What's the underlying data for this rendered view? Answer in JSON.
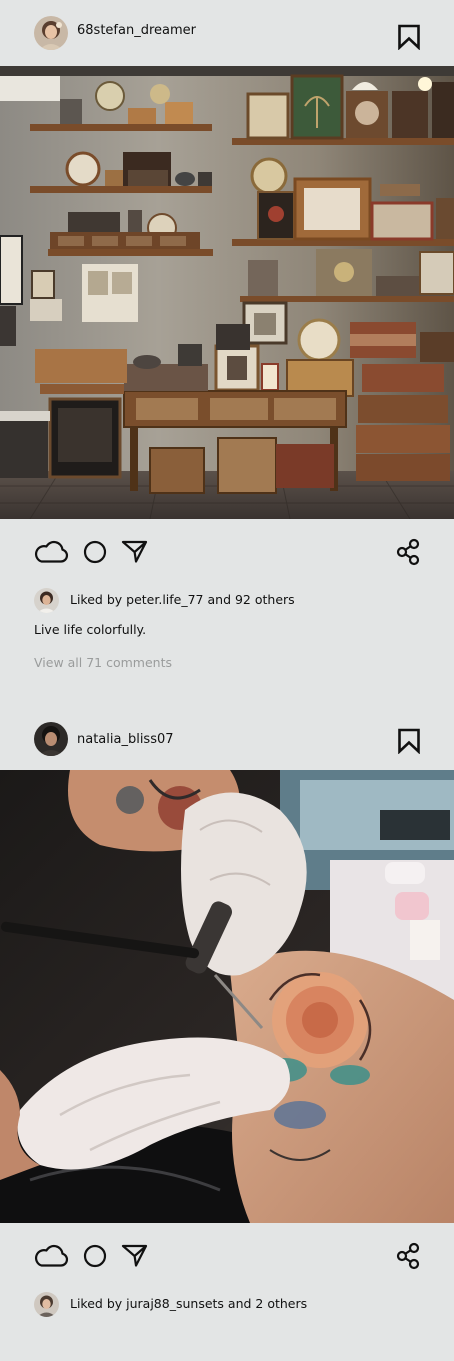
{
  "theme": {
    "background": "#e3e5e5",
    "text": "#111111",
    "muted_text": "#9a9c9c"
  },
  "posts": [
    {
      "username": "68stefan_dreamer",
      "photo_subject": "Vintage workshop with wooden shelves of clocks, frames and crates",
      "liked_by_text": "Liked by peter.life_77 and 92 others",
      "caption": "Live life colorfully.",
      "comments_link": "View all 71 comments",
      "icons": {
        "bookmark": "bookmark-icon",
        "like": "cloud-icon",
        "comment": "circle-icon",
        "send": "send-icon",
        "share": "share-icon"
      }
    },
    {
      "username": "natalia_bliss07",
      "photo_subject": "Tattoo artist in white gloves tattooing a floral design on an arm",
      "liked_by_text": "Liked by juraj88_sunsets and 2 others",
      "icons": {
        "bookmark": "bookmark-icon",
        "like": "cloud-icon",
        "comment": "circle-icon",
        "send": "send-icon",
        "share": "share-icon"
      }
    }
  ]
}
